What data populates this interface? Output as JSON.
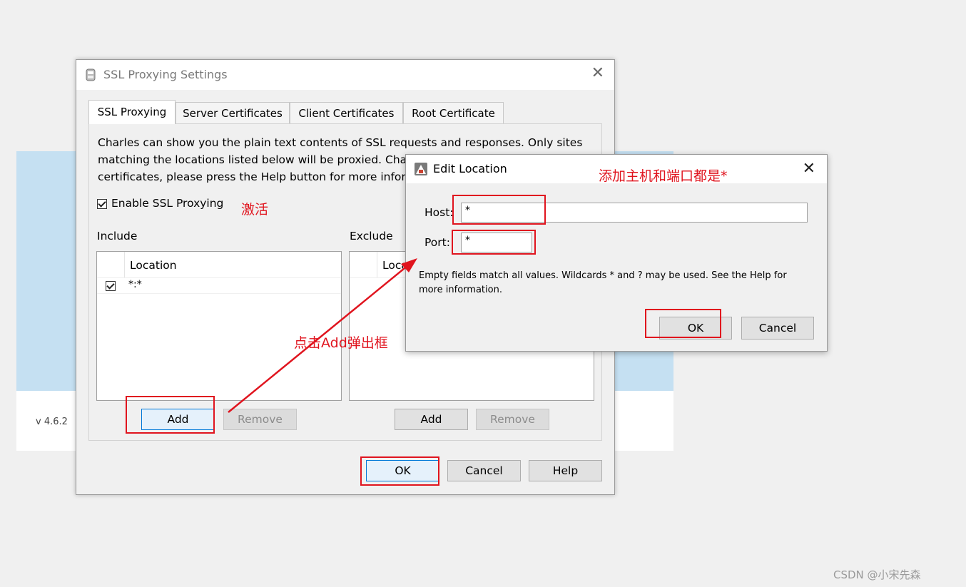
{
  "background": {
    "version": "v 4.6.2"
  },
  "watermark": "CSDN @小宋先森",
  "dialog": {
    "title": "SSL Proxying Settings",
    "tabs": [
      "SSL Proxying",
      "Server Certificates",
      "Client Certificates",
      "Root Certificate"
    ],
    "description": "Charles can show you the plain text contents of SSL requests and responses. Only sites matching the locations listed below will be proxied. Charles will issue and sign SSL certificates, please press the Help button for more information.",
    "enable_label": "Enable SSL Proxying",
    "include_label": "Include",
    "exclude_label": "Exclude",
    "include_column": "Location",
    "exclude_column": "Location",
    "include_rows": [
      {
        "checked": true,
        "location": "*:*"
      }
    ],
    "add_label": "Add",
    "remove_label": "Remove",
    "ok_label": "OK",
    "cancel_label": "Cancel",
    "help_label": "Help"
  },
  "edit_location": {
    "title": "Edit Location",
    "host_label": "Host:",
    "host_value": "*",
    "port_label": "Port:",
    "port_value": "*",
    "hint": "Empty fields match all values. Wildcards * and ? may be used. See the Help for more information.",
    "ok_label": "OK",
    "cancel_label": "Cancel"
  },
  "annotations": {
    "activate": "激活",
    "add_popup": "点击Add弹出框",
    "host_port": "添加主机和端口都是*",
    "color": "#e0141e"
  }
}
